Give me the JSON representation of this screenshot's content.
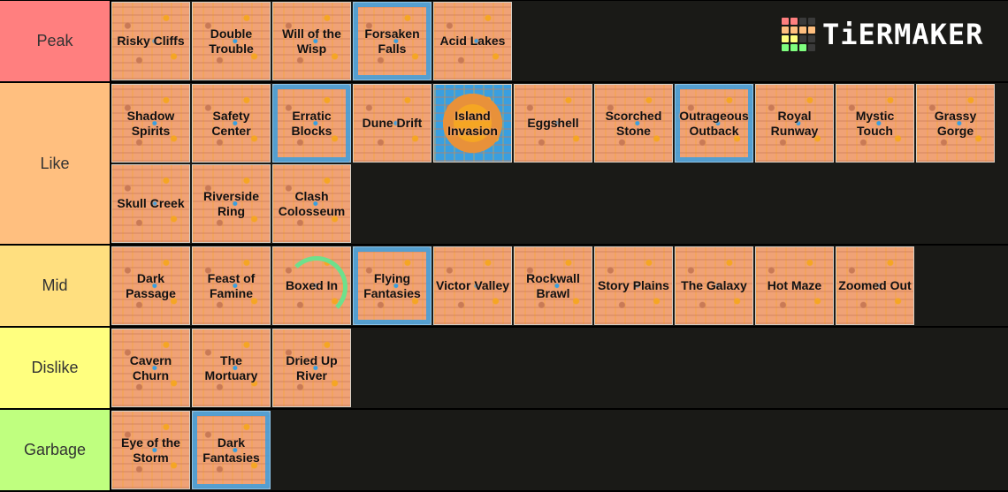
{
  "logo": {
    "text": "TiERMAKER",
    "grid_colors": [
      "#ff7f7f",
      "#ff7f7f",
      "#3a3a3a",
      "#3a3a3a",
      "#ffbf7f",
      "#ffbf7f",
      "#ffbf7f",
      "#ffbf7f",
      "#ffff7f",
      "#ffff7f",
      "#3a3a3a",
      "#3a3a3a",
      "#7fff7f",
      "#7fff7f",
      "#7fff7f",
      "#3a3a3a"
    ]
  },
  "tiers": [
    {
      "label": "Peak",
      "color": "#ff7f7f",
      "items": [
        "Risky Cliffs",
        "Double Trouble",
        "Will of the Wisp",
        "Forsaken Falls",
        "Acid Lakes"
      ]
    },
    {
      "label": "Like",
      "color": "#ffbf7f",
      "items": [
        "Shadow Spirits",
        "Safety Center",
        "Erratic Blocks",
        "Dune Drift",
        "Island Invasion",
        "Eggshell",
        "Scorched Stone",
        "Outrageous Outback",
        "Royal Runway",
        "Mystic Touch",
        "Grassy Gorge",
        "Skull Creek",
        "Riverside Ring",
        "Clash Colosseum"
      ]
    },
    {
      "label": "Mid",
      "color": "#ffdf7f",
      "items": [
        "Dark Passage",
        "Feast of Famine",
        "Boxed In",
        "Flying Fantasies",
        "Victor Valley",
        "Rockwall Brawl",
        "Story Plains",
        "The Galaxy",
        "Hot Maze",
        "Zoomed Out"
      ]
    },
    {
      "label": "Dislike",
      "color": "#ffff7f",
      "items": [
        "Cavern Churn",
        "The Mortuary",
        "Dried Up River"
      ]
    },
    {
      "label": "Garbage",
      "color": "#bfff7f",
      "items": [
        "Eye of the Storm",
        "Dark Fantasies"
      ]
    }
  ]
}
